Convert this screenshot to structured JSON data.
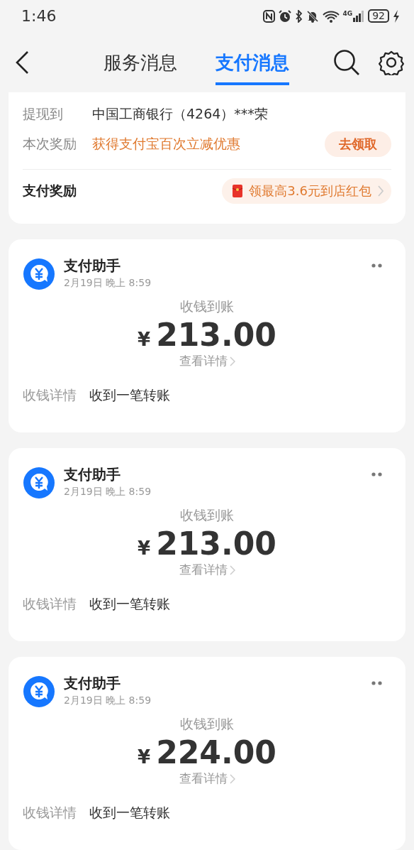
{
  "status_bar": {
    "time": "1:46",
    "network": "4G",
    "battery": "92"
  },
  "tabs": [
    {
      "label": "服务消息",
      "selected": false
    },
    {
      "label": "支付消息",
      "selected": true
    }
  ],
  "summary_card": {
    "rows": [
      {
        "label": "提现到",
        "value": "中国工商银行（4264）***荣",
        "kind": "plain"
      },
      {
        "label": "本次奖励",
        "value": "获得支付宝百次立减优惠",
        "kind": "promo",
        "action": "去领取"
      }
    ],
    "reward": {
      "title": "支付奖励",
      "offer": "领最高3.6元到店红包"
    }
  },
  "messages": [
    {
      "sender": "支付助手",
      "time": "2月19日 晚上 8:59",
      "heading": "收钱到账",
      "currency": "¥",
      "amount": "213.00",
      "link": "查看详情",
      "detail_label": "收钱详情",
      "detail_value": "收到一笔转账"
    },
    {
      "sender": "支付助手",
      "time": "2月19日 晚上 8:59",
      "heading": "收钱到账",
      "currency": "¥",
      "amount": "213.00",
      "link": "查看详情",
      "detail_label": "收钱详情",
      "detail_value": "收到一笔转账"
    },
    {
      "sender": "支付助手",
      "time": "2月19日 晚上 8:59",
      "heading": "收钱到账",
      "currency": "¥",
      "amount": "224.00",
      "link": "查看详情",
      "detail_label": "收钱详情",
      "detail_value": "收到一笔转账"
    }
  ]
}
